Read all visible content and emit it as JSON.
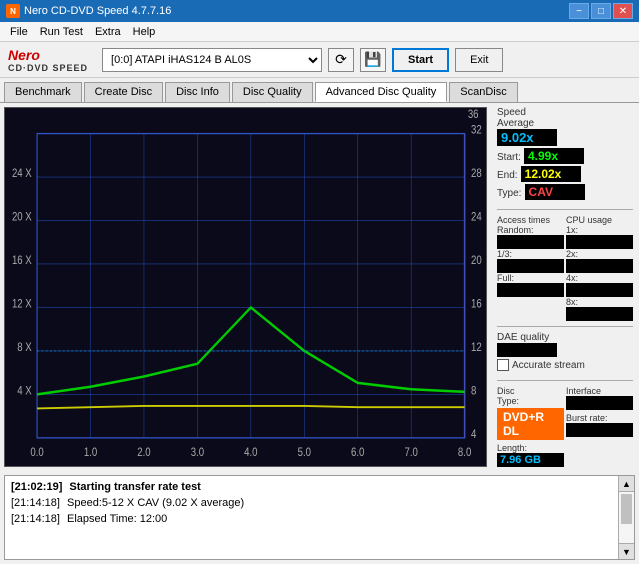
{
  "titlebar": {
    "title": "Nero CD-DVD Speed 4.7.7.16",
    "icon": "N",
    "min_label": "−",
    "max_label": "□",
    "close_label": "✕"
  },
  "menubar": {
    "items": [
      "File",
      "Run Test",
      "Extra",
      "Help"
    ]
  },
  "toolbar": {
    "nero_top": "Nero",
    "nero_bottom": "CD·DVD SPEED",
    "drive_value": "[0:0]  ATAPI iHAS124  B AL0S",
    "start_label": "Start",
    "exit_label": "Exit"
  },
  "tabs": [
    {
      "label": "Benchmark",
      "active": false
    },
    {
      "label": "Create Disc",
      "active": false
    },
    {
      "label": "Disc Info",
      "active": false
    },
    {
      "label": "Disc Quality",
      "active": false
    },
    {
      "label": "Advanced Disc Quality",
      "active": false
    },
    {
      "label": "ScanDisc",
      "active": false
    }
  ],
  "stats": {
    "speed_label": "Speed",
    "average_label": "Average",
    "average_value": "9.02x",
    "start_label": "Start:",
    "start_value": "4.99x",
    "end_label": "End:",
    "end_value": "12.02x",
    "type_label": "Type:",
    "type_value": "CAV",
    "access_times_label": "Access times",
    "random_label": "Random:",
    "random_value": "",
    "one_third_label": "1/3:",
    "one_third_value": "",
    "full_label": "Full:",
    "full_value": "",
    "dae_label": "DAE quality",
    "dae_value": "",
    "accurate_stream_label": "Accurate stream",
    "cpu_label": "CPU usage",
    "cpu_1x_label": "1x:",
    "cpu_1x_value": "",
    "cpu_2x_label": "2x:",
    "cpu_2x_value": "",
    "cpu_4x_label": "4x:",
    "cpu_4x_value": "",
    "cpu_8x_label": "8x:",
    "cpu_8x_value": "",
    "disc_label": "Disc",
    "disc_type_label": "Type:",
    "disc_type_value": "DVD+R DL",
    "disc_length_label": "Length:",
    "disc_length_value": "7.96 GB",
    "interface_label": "Interface",
    "burst_label": "Burst rate:"
  },
  "log": {
    "rows": [
      {
        "time": "[21:02:19]",
        "text": "Starting transfer rate test",
        "bold": true
      },
      {
        "time": "[21:14:18]",
        "text": "Speed:5-12 X CAV (9.02 X average)",
        "bold": false
      },
      {
        "time": "[21:14:18]",
        "text": "Elapsed Time: 12:00",
        "bold": false
      }
    ]
  },
  "chart": {
    "x_labels": [
      "0.0",
      "1.0",
      "2.0",
      "3.0",
      "4.0",
      "5.0",
      "6.0",
      "7.0",
      "8.0"
    ],
    "y_left": [
      "4 X",
      "8 X",
      "12 X",
      "16 X",
      "20 X",
      "24 X"
    ],
    "y_right": [
      "4",
      "8",
      "12",
      "16",
      "20",
      "24",
      "28",
      "32",
      "36"
    ]
  }
}
